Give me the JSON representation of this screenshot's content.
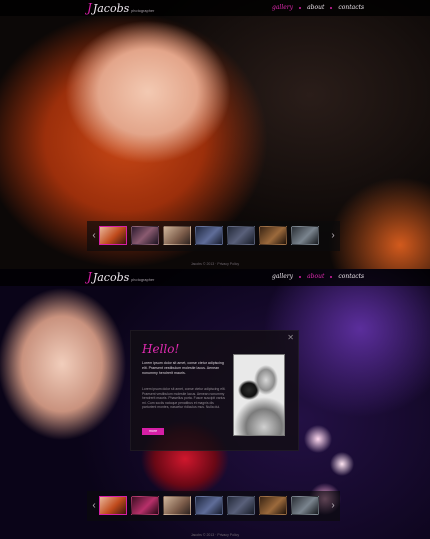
{
  "site": {
    "logo_initial": "J",
    "logo_name": "Jacobs",
    "logo_tagline": "photographer"
  },
  "nav": [
    {
      "label": "gallery"
    },
    {
      "label": "about"
    },
    {
      "label": "contacts"
    }
  ],
  "screens": [
    {
      "active_nav": "gallery",
      "active_thumb": 1,
      "footer": "Jacobs © 2013 · Privacy Policy"
    },
    {
      "active_nav": "about",
      "active_thumb": 1,
      "footer": "Jacobs © 2013 · Privacy Policy"
    }
  ],
  "gallery": {
    "thumb_count": 7,
    "prev_icon": "chevron-left-icon",
    "next_icon": "chevron-right-icon"
  },
  "modal": {
    "title": "Hello!",
    "lead": "Lorem ipsum dolor sit amet, conse ctetur adipiscing elit. Praesent vestibulum molestie lacus. Aenean nonummy hendrerit mauris.",
    "body": "Lorem ipsum dolor sit amet, conse ctetur adipiscing elit. Praesent vestibulum molestie lacus. Aenean nonummy hendrerit mauris. Phasellus porta. Fusce suscipit varius mi. Cum sociis natoque penatibus et magnis dis parturient montes, nascetur ridiculus mus. Nulla dui.",
    "button": "more",
    "close_icon": "close-icon"
  },
  "colors": {
    "accent": "#d61fa6"
  }
}
